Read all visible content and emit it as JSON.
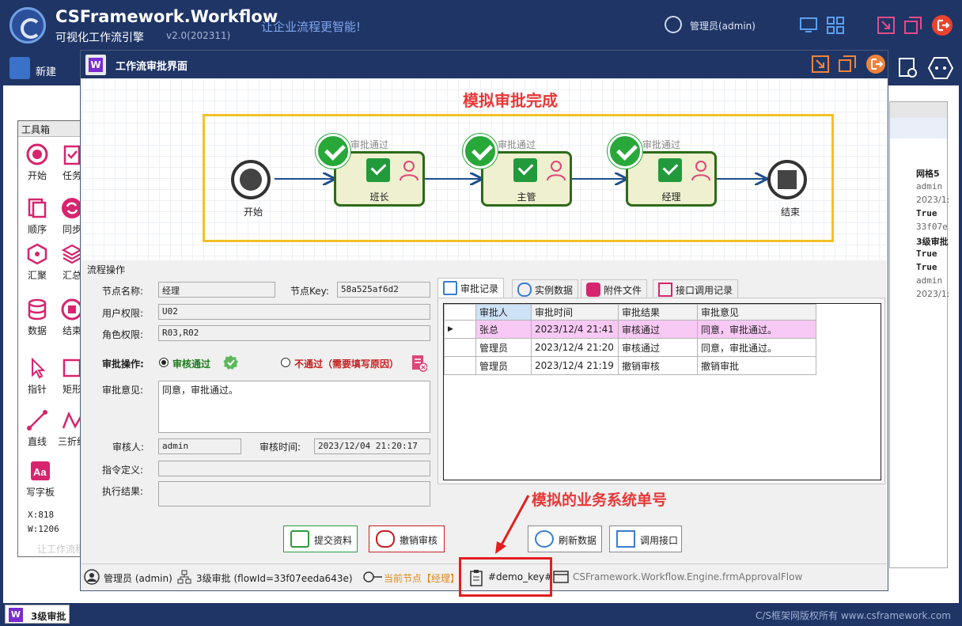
{
  "app": {
    "title": "CSFramework.Workflow",
    "subtitle": "可视化工作流引擎",
    "version": "v2.0(202311)",
    "slogan": "让企业流程更智能!",
    "user": "管理员(admin)",
    "new_label": "新建"
  },
  "toolbox": {
    "title": "工具箱",
    "items": [
      "开始",
      "任务",
      "顺序",
      "同步",
      "汇聚",
      "汇总",
      "数据",
      "结束",
      "指针",
      "矩形",
      "直线",
      "三折线",
      "写字板"
    ],
    "coord_x": "X:818",
    "coord_w": "W:1206",
    "footer": "让工作流程"
  },
  "right_panel": {
    "lines": [
      "网格5",
      "admin",
      "2023/1:",
      "True",
      "33f07e",
      "3级审批",
      "True",
      "True",
      "admin",
      "2023/1:"
    ]
  },
  "dialog": {
    "title": "工作流审批界面",
    "flow_title": "模拟审批完成",
    "nodes": {
      "start": "开始",
      "n1": "班长",
      "n2": "主管",
      "n3": "经理",
      "end": "结束",
      "approved": "审批通过"
    },
    "section": "流程操作",
    "labels": {
      "node_name": "节点名称:",
      "node_key": "节点Key:",
      "user_perm": "用户权限:",
      "role_perm": "角色权限:",
      "approve_op": "审批操作:",
      "approve_pass": "审核通过",
      "approve_fail": "不通过（需要填写原因）",
      "comment": "审批意见:",
      "reviewer": "审核人:",
      "review_time": "审核时间:",
      "cmd_def": "指令定义:",
      "exec_result": "执行结果:"
    },
    "values": {
      "node_name": "经理",
      "node_key": "58a525af6d2",
      "user_perm": "U02",
      "role_perm": "R03,R02",
      "comment": "同意，审批通过。",
      "reviewer": "admin",
      "review_time": "2023/12/04 21:20:17",
      "cmd_def": "",
      "exec_result": ""
    },
    "tabs": [
      "审批记录",
      "实例数据",
      "附件文件",
      "接口调用记录"
    ],
    "grid": {
      "headers": [
        "审批人",
        "审批时间",
        "审批结果",
        "审批意见"
      ],
      "rows": [
        [
          "张总",
          "2023/12/4 21:41",
          "审核通过",
          "同意，审批通过。"
        ],
        [
          "管理员",
          "2023/12/4 21:20",
          "审核通过",
          "同意，审批通过。"
        ],
        [
          "管理员",
          "2023/12/4 21:19",
          "撤销审核",
          "撤销审批"
        ]
      ]
    },
    "buttons": {
      "submit": "提交资料",
      "revoke": "撤销审核",
      "refresh": "刷新数据",
      "call_api": "调用接口"
    },
    "status": {
      "user": "管理员 (admin)",
      "flow": "3级审批 (flowId=33f07eeda643e)",
      "current_node": "当前节点【经理】",
      "key": "#demo_key#",
      "form": "CSFramework.Workflow.Engine.frmApprovalFlow"
    }
  },
  "annotation": "模拟的业务系统单号",
  "taskbar": {
    "item": "3级审批",
    "copyright": "C/S框架网版权所有 www.csframework.com"
  },
  "colors": {
    "header_bg": "#1f3566",
    "accent_red": "#e83838",
    "approve_green": "#29a83a",
    "flow_box": "#f5c026",
    "selected_row": "#f8c9f5"
  }
}
